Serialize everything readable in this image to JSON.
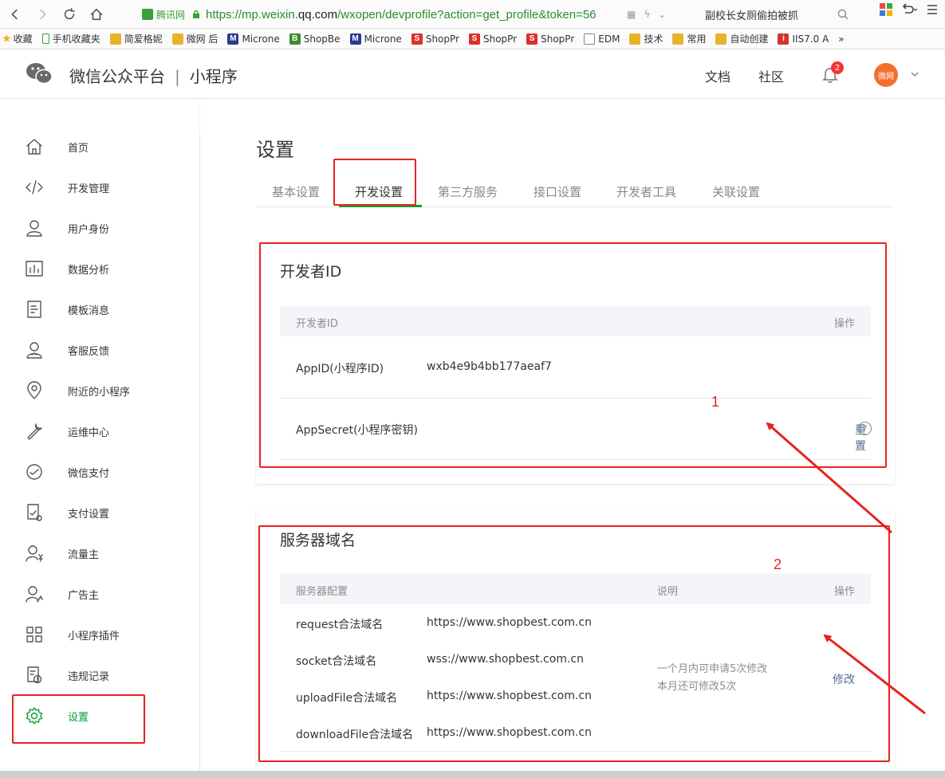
{
  "browser": {
    "site_name": "腾讯网",
    "url_prefix": "https://mp.weixin.",
    "url_domain": "qq.com",
    "url_rest": "/wxopen/devprofile?action=get_profile&token=56",
    "search_text": "副校长女厕偷拍被抓",
    "bookmarks": [
      {
        "label": "收藏",
        "icon": "star-icon"
      },
      {
        "label": "手机收藏夹",
        "icon": "phone-icon"
      },
      {
        "label": "简爱格妮",
        "icon": "folder-icon"
      },
      {
        "label": "微网 后",
        "icon": "folder-icon"
      },
      {
        "label": "Microne",
        "icon": "m-icon"
      },
      {
        "label": "ShopBe",
        "icon": "b-icon"
      },
      {
        "label": "Microne",
        "icon": "m-icon"
      },
      {
        "label": "ShopPr",
        "icon": "s-icon"
      },
      {
        "label": "ShopPr",
        "icon": "s-icon"
      },
      {
        "label": "ShopPr",
        "icon": "s-icon"
      },
      {
        "label": "EDM",
        "icon": "doc-icon"
      },
      {
        "label": "技术",
        "icon": "folder-icon"
      },
      {
        "label": "常用",
        "icon": "folder-icon"
      },
      {
        "label": "自动创建",
        "icon": "folder-icon"
      },
      {
        "label": "IIS7.0 A",
        "icon": "iis-icon"
      }
    ],
    "more": "»"
  },
  "header": {
    "brand": "微信公众平台",
    "separator": "|",
    "product": "小程序",
    "docs": "文档",
    "community": "社区",
    "notifications": "2",
    "avatar_text": "微网"
  },
  "sidebar": {
    "items": [
      {
        "label": "首页",
        "icon": "home-icon"
      },
      {
        "label": "开发管理",
        "icon": "code-icon"
      },
      {
        "label": "用户身份",
        "icon": "user-icon"
      },
      {
        "label": "数据分析",
        "icon": "chart-icon"
      },
      {
        "label": "模板消息",
        "icon": "document-icon"
      },
      {
        "label": "客服反馈",
        "icon": "service-icon"
      },
      {
        "label": "附近的小程序",
        "icon": "location-icon"
      },
      {
        "label": "运维中心",
        "icon": "wrench-icon"
      },
      {
        "label": "微信支付",
        "icon": "pay-icon"
      },
      {
        "label": "支付设置",
        "icon": "pay-settings-icon"
      },
      {
        "label": "流量主",
        "icon": "traffic-icon"
      },
      {
        "label": "广告主",
        "icon": "advertiser-icon"
      },
      {
        "label": "小程序插件",
        "icon": "plugin-icon"
      },
      {
        "label": "违规记录",
        "icon": "record-icon"
      },
      {
        "label": "设置",
        "icon": "gear-icon"
      }
    ],
    "active_index": 14
  },
  "main": {
    "title": "设置",
    "tabs": [
      "基本设置",
      "开发设置",
      "第三方服务",
      "接口设置",
      "开发者工具",
      "关联设置"
    ],
    "active_tab": 1,
    "developer_id": {
      "title": "开发者ID",
      "col_id": "开发者ID",
      "col_action": "操作",
      "appid_label": "AppID(小程序ID)",
      "appid_value": "wxb4e9b4bb177aeaf7",
      "secret_label": "AppSecret(小程序密钥)",
      "secret_action": "重置",
      "help": "?"
    },
    "server_domain": {
      "title": "服务器域名",
      "col_config": "服务器配置",
      "col_note": "说明",
      "col_action": "操作",
      "rows": [
        {
          "label": "request合法域名",
          "value": "https://www.shopbest.com.cn"
        },
        {
          "label": "socket合法域名",
          "value": "wss://www.shopbest.com.cn"
        },
        {
          "label": "uploadFile合法域名",
          "value": "https://www.shopbest.com.cn"
        },
        {
          "label": "downloadFile合法域名",
          "value": "https://www.shopbest.com.cn"
        }
      ],
      "note_line1": "一个月内可申请5次修改",
      "note_line2": "本月还可修改5次",
      "action": "修改"
    }
  },
  "annotations": {
    "one": "1",
    "two": "2"
  },
  "colors": {
    "accent": "#07a130",
    "annotation": "#e8231f",
    "link": "#576b95"
  }
}
